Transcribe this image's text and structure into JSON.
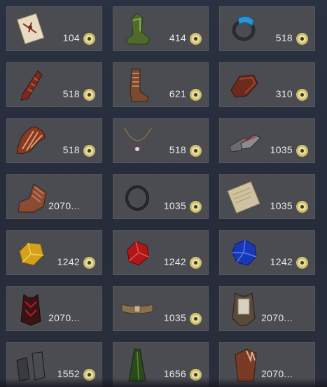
{
  "inventory": {
    "items": [
      {
        "icon": "scroll-icon",
        "price": "104"
      },
      {
        "icon": "green-boots-icon",
        "price": "414"
      },
      {
        "icon": "blue-ring-icon",
        "price": "518"
      },
      {
        "icon": "red-gauntlet-icon",
        "price": "518"
      },
      {
        "icon": "brown-boots-icon",
        "price": "621"
      },
      {
        "icon": "red-armguard-icon",
        "price": "310"
      },
      {
        "icon": "feathered-shoulder-icon",
        "price": "518"
      },
      {
        "icon": "necklace-icon",
        "price": "518"
      },
      {
        "icon": "silver-shoes-icon",
        "price": "1035"
      },
      {
        "icon": "winged-boots-icon",
        "price": "2070..."
      },
      {
        "icon": "dark-ring-icon",
        "price": "1035"
      },
      {
        "icon": "parchment-icon",
        "price": "1035"
      },
      {
        "icon": "yellow-gem-icon",
        "price": "1242"
      },
      {
        "icon": "red-gem-icon",
        "price": "1242"
      },
      {
        "icon": "blue-gem-icon",
        "price": "1242"
      },
      {
        "icon": "red-vest-icon",
        "price": "2070..."
      },
      {
        "icon": "belt-icon",
        "price": "1035"
      },
      {
        "icon": "armor-chest-icon",
        "price": "2070..."
      },
      {
        "icon": "gloves-icon",
        "price": "1552"
      },
      {
        "icon": "green-cloak-icon",
        "price": "1656"
      },
      {
        "icon": "winged-armor-icon",
        "price": "2070..."
      }
    ],
    "currency_icon": "gold-coin-icon"
  }
}
